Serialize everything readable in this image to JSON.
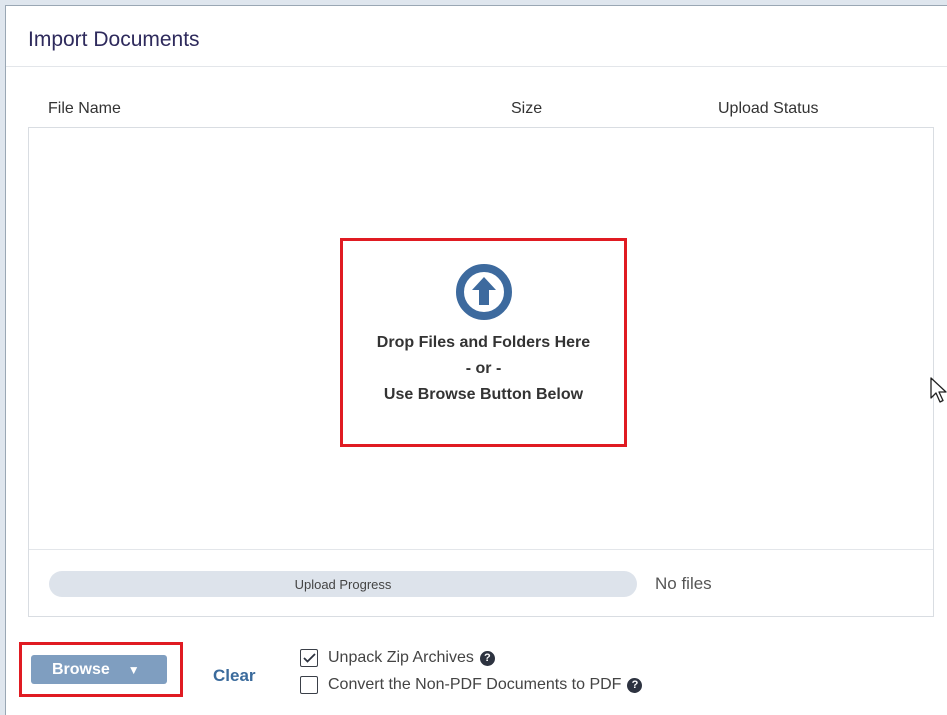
{
  "dialog": {
    "title": "Import Documents"
  },
  "table": {
    "columns": [
      "File Name",
      "Size",
      "Upload Status"
    ]
  },
  "drop_zone": {
    "icon": "upload-arrow-circle-icon",
    "line1": "Drop Files and Folders Here",
    "line2": "- or -",
    "line3": "Use Browse Button Below"
  },
  "progress": {
    "label": "Upload Progress",
    "status": "No files"
  },
  "footer": {
    "browse_label": "Browse",
    "clear_label": "Clear",
    "options": [
      {
        "label": "Unpack Zip Archives",
        "checked": true
      },
      {
        "label": "Convert the Non-PDF Documents to PDF",
        "checked": false
      }
    ]
  },
  "colors": {
    "title": "#2e2a5c",
    "highlight": "#e01b22",
    "icon": "#3d6a9e",
    "browse_button": "#7f9ec0",
    "clear_link": "#3b6b9c"
  }
}
